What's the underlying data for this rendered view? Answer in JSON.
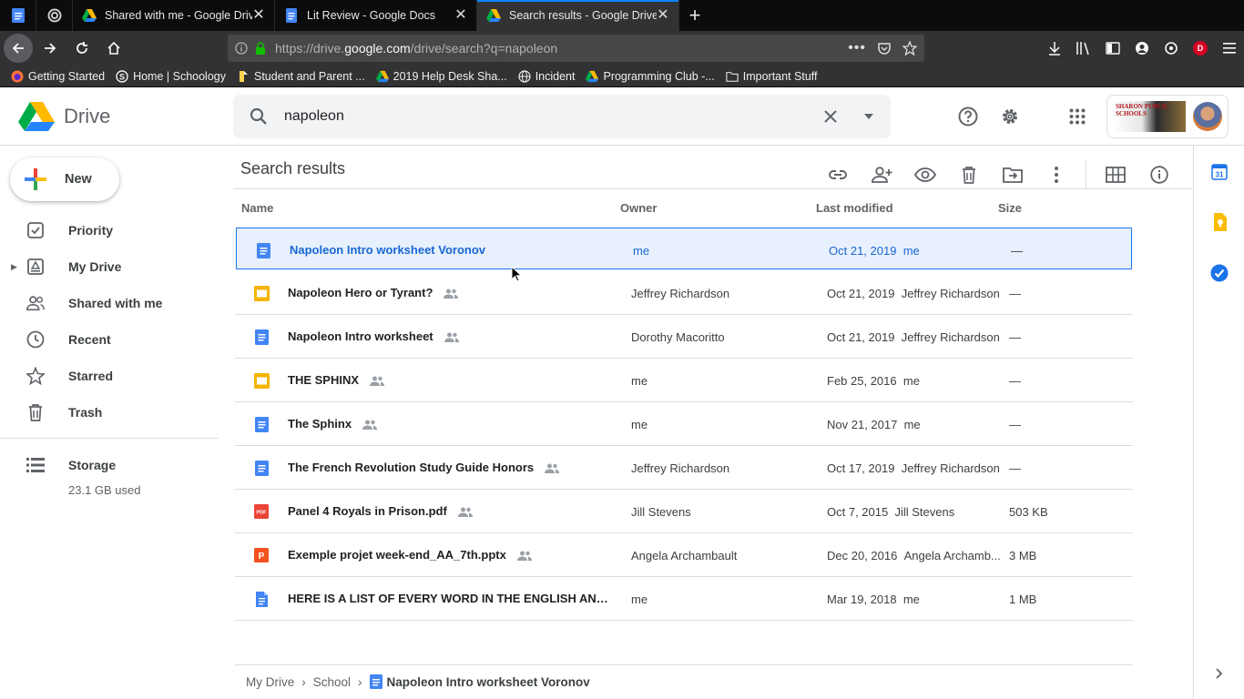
{
  "browser": {
    "tabs": [
      {
        "label": "Shared with me - Google Drive",
        "icon": "drive-icon",
        "active": false
      },
      {
        "label": "Lit Review - Google Docs",
        "icon": "docs-icon",
        "active": false
      },
      {
        "label": "Search results - Google Drive",
        "icon": "drive-icon",
        "active": true
      }
    ],
    "url_prefix": "https://drive.",
    "url_domain": "google.com",
    "url_path": "/drive/search?q=napoleon",
    "bookmarks": [
      {
        "label": "Getting Started",
        "icon": "firefox-icon"
      },
      {
        "label": "Home | Schoology",
        "icon": "schoology-icon"
      },
      {
        "label": "Student and Parent ...",
        "icon": "bookmark-page-icon"
      },
      {
        "label": "2019 Help Desk Sha...",
        "icon": "drive-icon"
      },
      {
        "label": "Incident",
        "icon": "globe-icon"
      },
      {
        "label": "Programming Club -...",
        "icon": "drive-icon"
      },
      {
        "label": "Important Stuff",
        "icon": "folder-icon"
      }
    ],
    "profile_initial": "D"
  },
  "header": {
    "logo_text": "Drive",
    "search_value": "napoleon",
    "school_text": "SHARON PUBLIC SCHOOLS"
  },
  "sidebar": {
    "new_label": "New",
    "items": [
      {
        "label": "Priority",
        "icon": "priority-icon"
      },
      {
        "label": "My Drive",
        "icon": "my-drive-icon"
      },
      {
        "label": "Shared with me",
        "icon": "shared-with-me-icon"
      },
      {
        "label": "Recent",
        "icon": "clock-icon"
      },
      {
        "label": "Starred",
        "icon": "star-icon"
      },
      {
        "label": "Trash",
        "icon": "trash-icon"
      },
      {
        "label": "Storage",
        "icon": "storage-icon"
      }
    ],
    "storage_used": "23.1 GB used"
  },
  "main": {
    "title": "Search results",
    "columns": {
      "name": "Name",
      "owner": "Owner",
      "modified": "Last modified",
      "size": "Size"
    },
    "files": [
      {
        "name": "Napoleon Intro worksheet Voronov",
        "type": "doc",
        "shared": false,
        "owner": "me",
        "modified": "Oct 21, 2019",
        "modified_by": "me",
        "size": "—",
        "selected": true
      },
      {
        "name": "Napoleon Hero or Tyrant?",
        "type": "slides",
        "shared": true,
        "owner": "Jeffrey Richardson",
        "modified": "Oct 21, 2019",
        "modified_by": "Jeffrey Richardson",
        "size": "—",
        "selected": false
      },
      {
        "name": "Napoleon Intro worksheet",
        "type": "doc",
        "shared": true,
        "owner": "Dorothy Macoritto",
        "modified": "Oct 21, 2019",
        "modified_by": "Jeffrey Richardson",
        "size": "—",
        "selected": false
      },
      {
        "name": "THE SPHINX",
        "type": "slides",
        "shared": true,
        "owner": "me",
        "modified": "Feb 25, 2016",
        "modified_by": "me",
        "size": "—",
        "selected": false
      },
      {
        "name": "The Sphinx",
        "type": "doc",
        "shared": true,
        "owner": "me",
        "modified": "Nov 21, 2017",
        "modified_by": "me",
        "size": "—",
        "selected": false
      },
      {
        "name": "The French Revolution Study Guide Honors",
        "type": "doc",
        "shared": true,
        "owner": "Jeffrey Richardson",
        "modified": "Oct 17, 2019",
        "modified_by": "Jeffrey Richardson",
        "size": "—",
        "selected": false
      },
      {
        "name": "Panel 4 Royals in Prison.pdf",
        "type": "pdf",
        "shared": true,
        "owner": "Jill Stevens",
        "modified": "Oct 7, 2015",
        "modified_by": "Jill Stevens",
        "size": "503 KB",
        "selected": false
      },
      {
        "name": "Exemple projet week-end_AA_7th.pptx",
        "type": "pptx",
        "shared": true,
        "owner": "Angela Archambault",
        "modified": "Dec 20, 2016",
        "modified_by": "Angela Archamb...",
        "size": "3 MB",
        "selected": false
      },
      {
        "name": "HERE IS A LIST OF EVERY WORD IN THE ENGLISH AND LAT...",
        "type": "docfile",
        "shared": false,
        "owner": "me",
        "modified": "Mar 19, 2018",
        "modified_by": "me",
        "size": "1 MB",
        "selected": false
      }
    ],
    "breadcrumb": {
      "root": "My Drive",
      "folder": "School",
      "current": "Napoleon Intro worksheet Voronov"
    }
  },
  "colors": {
    "accent": "#1a73e8",
    "selected_bg": "#e8f0fe",
    "doc_blue": "#4285f4",
    "slides_yellow": "#f4b400",
    "pdf_red": "#ea4335",
    "pptx_orange": "#f4511e"
  }
}
